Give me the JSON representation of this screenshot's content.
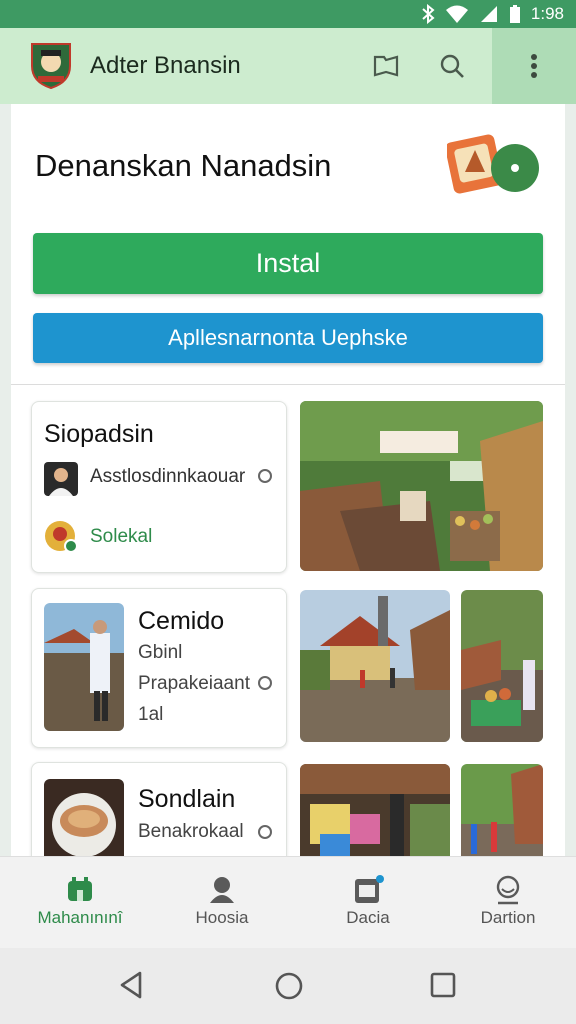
{
  "status_bar": {
    "time": "1:98",
    "icons": [
      "bluetooth-icon",
      "wifi-icon",
      "signal-icon",
      "battery-icon"
    ]
  },
  "app_bar": {
    "title": "Adter Bnansin",
    "actions": [
      "bookmark-icon",
      "search-icon",
      "more-vert-icon"
    ]
  },
  "page": {
    "title": "Denanskan Nanadsin",
    "install_label": "Instal",
    "secondary_label": "Apllesnarnonta Uephske"
  },
  "cards": [
    {
      "title": "Siopadsin",
      "author": "Asstlosdinnkaouar",
      "tag": "Solekal"
    },
    {
      "title": "Cemido",
      "line1": "Gbinl",
      "line2": "Prapakeiaant",
      "line3": "1al"
    },
    {
      "title": "Sondlain",
      "line1": "Benakrokaal"
    }
  ],
  "bottom_nav": {
    "items": [
      {
        "label": "Mahanınınî",
        "icon": "home-icon",
        "active": true
      },
      {
        "label": "Hoosia",
        "icon": "person-icon",
        "active": false
      },
      {
        "label": "Dacia",
        "icon": "calendar-icon",
        "active": false
      },
      {
        "label": "Dartion",
        "icon": "account-icon",
        "active": false
      }
    ]
  },
  "colors": {
    "primary": "#2eaa5c",
    "secondary": "#1e94cf",
    "status_bar": "#3e9a63",
    "app_bar": "#cdeccf"
  }
}
